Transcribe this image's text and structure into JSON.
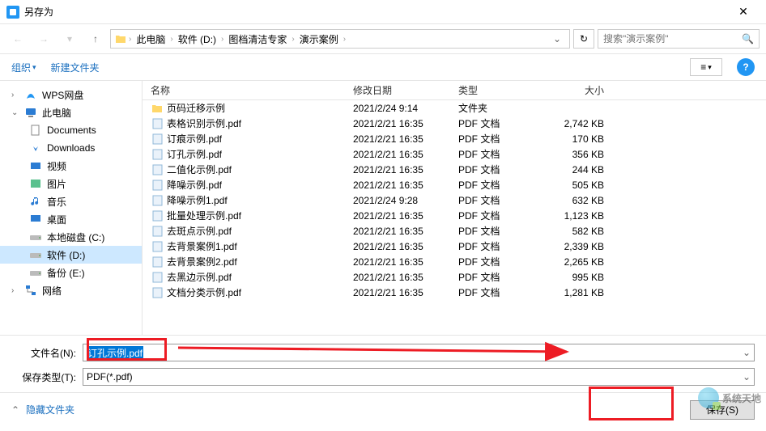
{
  "title": "另存为",
  "breadcrumb": [
    "此电脑",
    "软件 (D:)",
    "图档清洁专家",
    "演示案例"
  ],
  "search_placeholder": "搜索\"演示案例\"",
  "toolbar": {
    "organize": "组织",
    "newfolder": "新建文件夹"
  },
  "sidebar": [
    {
      "label": "WPS网盘",
      "icon": "wps",
      "indent": 0
    },
    {
      "label": "此电脑",
      "icon": "pc",
      "indent": 0,
      "expand": true
    },
    {
      "label": "Documents",
      "icon": "doc",
      "indent": 1
    },
    {
      "label": "Downloads",
      "icon": "down",
      "indent": 1
    },
    {
      "label": "视频",
      "icon": "video",
      "indent": 1
    },
    {
      "label": "图片",
      "icon": "pic",
      "indent": 1
    },
    {
      "label": "音乐",
      "icon": "music",
      "indent": 1
    },
    {
      "label": "桌面",
      "icon": "desktop",
      "indent": 1
    },
    {
      "label": "本地磁盘 (C:)",
      "icon": "drive",
      "indent": 1
    },
    {
      "label": "软件 (D:)",
      "icon": "drive",
      "indent": 1,
      "selected": true
    },
    {
      "label": "备份 (E:)",
      "icon": "drive",
      "indent": 1
    },
    {
      "label": "网络",
      "icon": "net",
      "indent": 0
    }
  ],
  "columns": {
    "name": "名称",
    "date": "修改日期",
    "type": "类型",
    "size": "大小"
  },
  "files": [
    {
      "name": "页码迁移示例",
      "date": "2021/2/24 9:14",
      "type": "文件夹",
      "size": "",
      "icon": "folder"
    },
    {
      "name": "表格识别示例.pdf",
      "date": "2021/2/21 16:35",
      "type": "PDF 文档",
      "size": "2,742 KB",
      "icon": "pdf"
    },
    {
      "name": "订痕示例.pdf",
      "date": "2021/2/21 16:35",
      "type": "PDF 文档",
      "size": "170 KB",
      "icon": "pdf"
    },
    {
      "name": "订孔示例.pdf",
      "date": "2021/2/21 16:35",
      "type": "PDF 文档",
      "size": "356 KB",
      "icon": "pdf"
    },
    {
      "name": "二值化示例.pdf",
      "date": "2021/2/21 16:35",
      "type": "PDF 文档",
      "size": "244 KB",
      "icon": "pdf"
    },
    {
      "name": "降噪示例.pdf",
      "date": "2021/2/21 16:35",
      "type": "PDF 文档",
      "size": "505 KB",
      "icon": "pdf"
    },
    {
      "name": "降噪示例1.pdf",
      "date": "2021/2/24 9:28",
      "type": "PDF 文档",
      "size": "632 KB",
      "icon": "pdf"
    },
    {
      "name": "批量处理示例.pdf",
      "date": "2021/2/21 16:35",
      "type": "PDF 文档",
      "size": "1,123 KB",
      "icon": "pdf"
    },
    {
      "name": "去斑点示例.pdf",
      "date": "2021/2/21 16:35",
      "type": "PDF 文档",
      "size": "582 KB",
      "icon": "pdf"
    },
    {
      "name": "去背景案例1.pdf",
      "date": "2021/2/21 16:35",
      "type": "PDF 文档",
      "size": "2,339 KB",
      "icon": "pdf"
    },
    {
      "name": "去背景案例2.pdf",
      "date": "2021/2/21 16:35",
      "type": "PDF 文档",
      "size": "2,265 KB",
      "icon": "pdf"
    },
    {
      "name": "去黑边示例.pdf",
      "date": "2021/2/21 16:35",
      "type": "PDF 文档",
      "size": "995 KB",
      "icon": "pdf"
    },
    {
      "name": "文档分类示例.pdf",
      "date": "2021/2/21 16:35",
      "type": "PDF 文档",
      "size": "1,281 KB",
      "icon": "pdf"
    }
  ],
  "form": {
    "filename_label": "文件名(N):",
    "filename_value": "订孔示例.pdf",
    "savetype_label": "保存类型(T):",
    "savetype_value": "PDF(*.pdf)"
  },
  "footer": {
    "hide": "隐藏文件夹",
    "save": "保存(S)"
  },
  "watermark": "系统天地"
}
